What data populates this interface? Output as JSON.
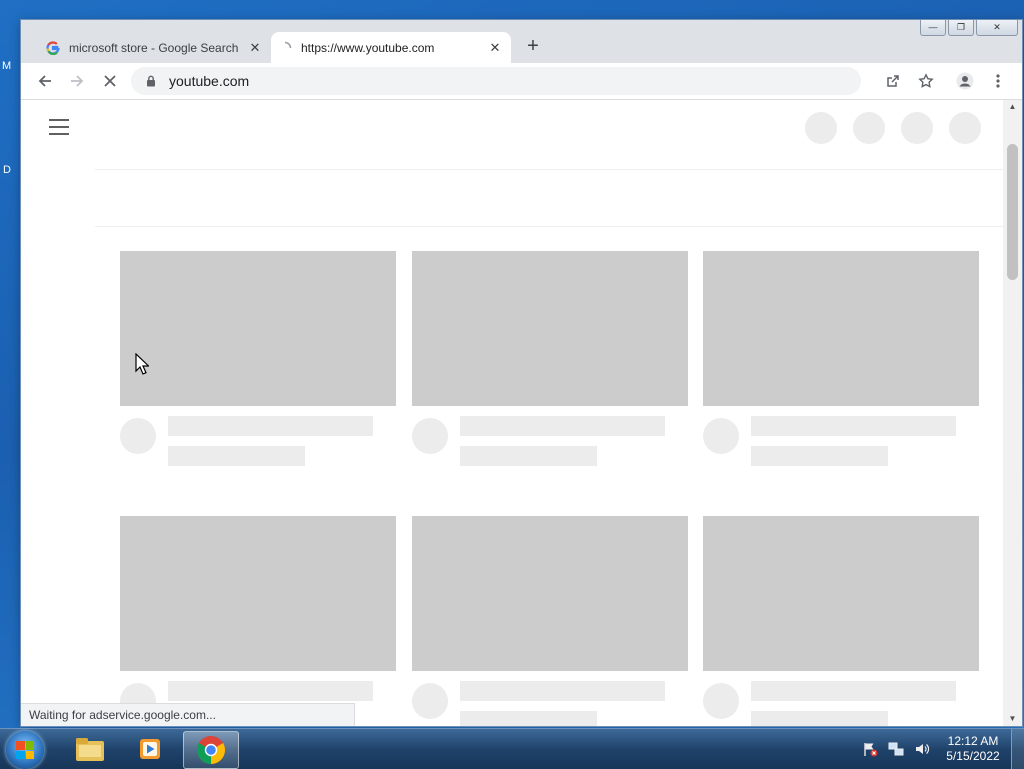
{
  "desktop": {
    "left_letters": [
      "M",
      "D"
    ]
  },
  "browser": {
    "tabs": [
      {
        "title": "microsoft store - Google Search",
        "favicon": "google-g-icon",
        "active": false
      },
      {
        "title": "https://www.youtube.com",
        "favicon": "loading-spinner-icon",
        "active": true
      }
    ],
    "new_tab_label": "+",
    "window_controls": {
      "minimize": "—",
      "restore": "❐",
      "close": "✕"
    },
    "address": {
      "url": "youtube.com"
    },
    "status_text": "Waiting for adservice.google.com..."
  },
  "taskbar": {
    "apps": [
      "windows-explorer-icon",
      "media-player-icon",
      "chrome-icon"
    ],
    "clock": {
      "time": "12:12 AM",
      "date": "5/15/2022"
    }
  },
  "colors": {
    "placeholder_thumb": "#cccccc",
    "placeholder_light": "#ececec",
    "chrome_tabbar": "#dee1e6"
  }
}
